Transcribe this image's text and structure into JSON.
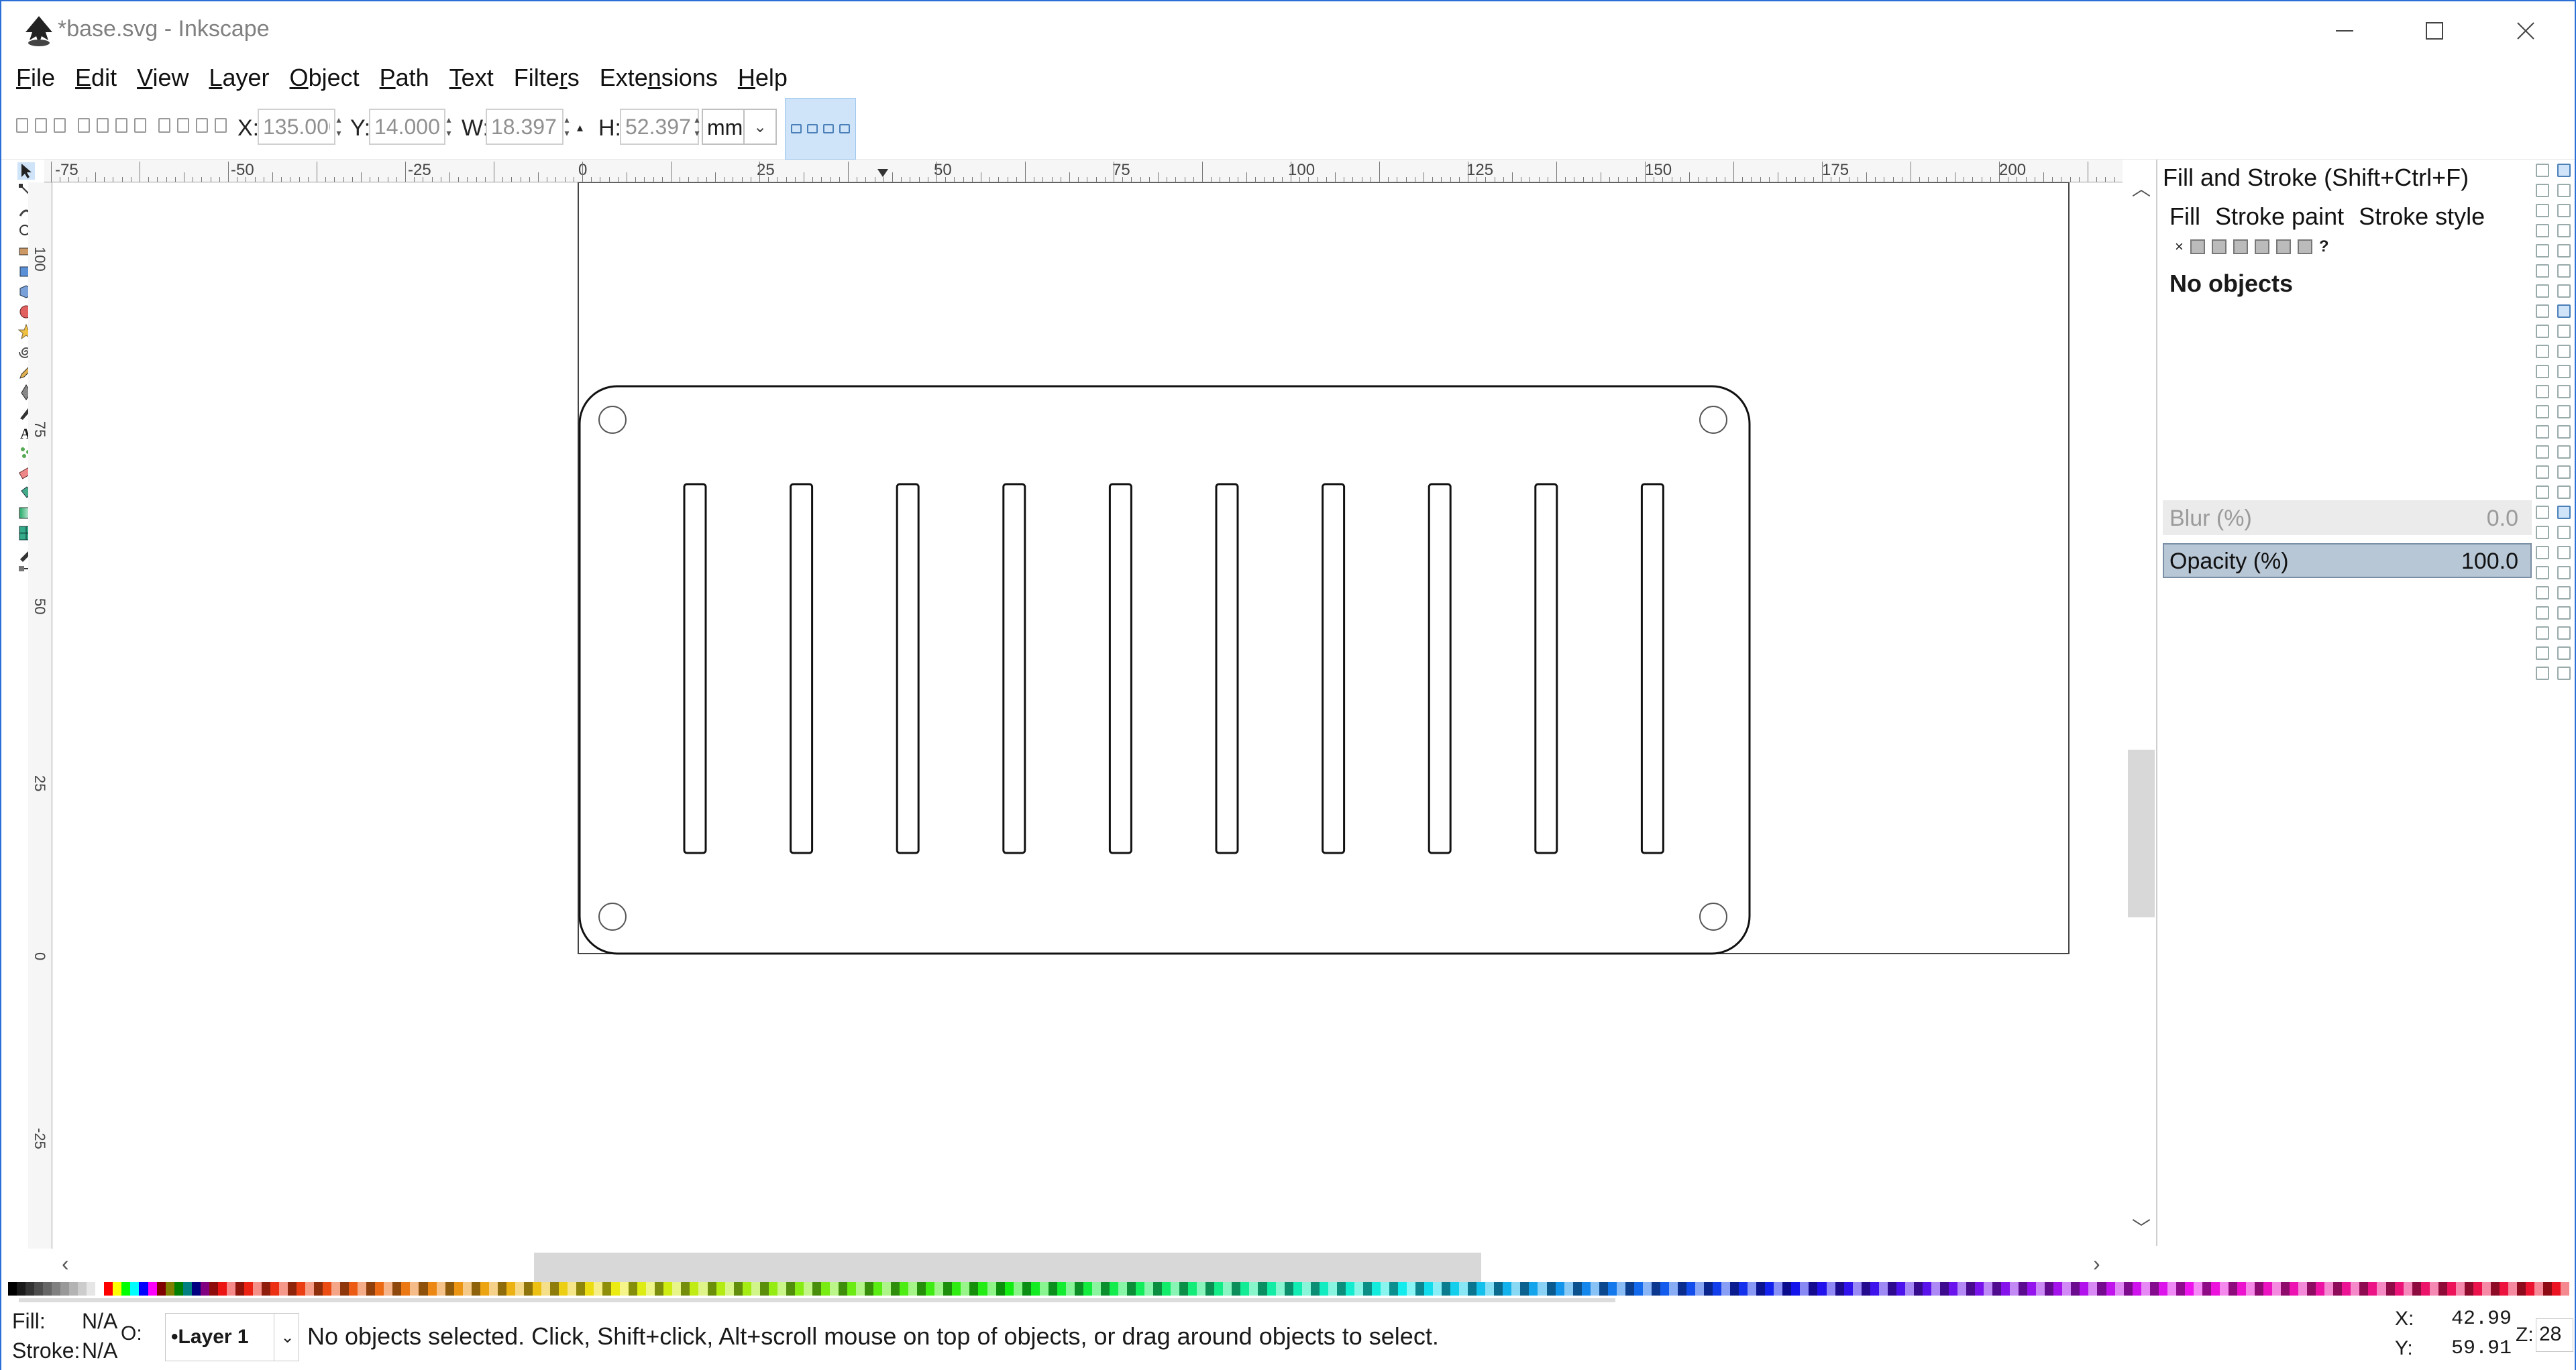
{
  "window": {
    "title": "*base.svg - Inkscape",
    "minimize_glyph": "—",
    "maximize_glyph": "☐",
    "close_glyph": "✕"
  },
  "menubar": {
    "items": [
      {
        "label": "File",
        "accel": "F"
      },
      {
        "label": "Edit",
        "accel": "E"
      },
      {
        "label": "View",
        "accel": "V"
      },
      {
        "label": "Layer",
        "accel": "L"
      },
      {
        "label": "Object",
        "accel": "O"
      },
      {
        "label": "Path",
        "accel": "P"
      },
      {
        "label": "Text",
        "accel": "T"
      },
      {
        "label": "Filters",
        "accel": "r"
      },
      {
        "label": "Extensions",
        "accel": "n"
      },
      {
        "label": "Help",
        "accel": "H"
      }
    ]
  },
  "tool_controls": {
    "x_label": "X:",
    "x_value": "135.000",
    "y_label": "Y:",
    "y_value": "14.000",
    "w_label": "W:",
    "w_value": "18.397",
    "h_label": "H:",
    "h_value": "52.397",
    "lock_glyph": "🔒",
    "unit": "mm"
  },
  "rulers": {
    "horizontal_labels": [
      "-75",
      "-50",
      "-25",
      "0",
      "25",
      "50",
      "75",
      "100",
      "125",
      "150",
      "175",
      "200"
    ],
    "vertical_labels": [
      "100",
      "75",
      "50",
      "25",
      "0",
      "-25"
    ]
  },
  "fill_stroke_dialog": {
    "title": "Fill and Stroke (Shift+Ctrl+F)",
    "tabs": [
      "Fill",
      "Stroke paint",
      "Stroke style"
    ],
    "no_paint_glyph": "×",
    "unknown_glyph": "?",
    "message": "No objects",
    "blur_label": "Blur (%)",
    "blur_value": "0.0",
    "opacity_label": "Opacity (%)",
    "opacity_value": "100.0"
  },
  "statusbar": {
    "fill_label": "Fill:",
    "fill_value": "N/A",
    "stroke_label": "Stroke:",
    "stroke_value": "N/A",
    "opacity_short": "O:",
    "layer": "•Layer 1",
    "message": "No objects selected. Click, Shift+click, Alt+scroll mouse on top of objects, or drag around objects to select.",
    "x_label": "X:",
    "x_value": "42.99",
    "y_label": "Y:",
    "y_value": "59.91",
    "zoom_label": "Z:",
    "zoom_value": "28"
  },
  "colors": {
    "accent": "#2b6fd6",
    "selection_highlight": "#cfe4f8",
    "opacity_row_bg": "#b8c7d6"
  },
  "drawing": {
    "slot_count": 10,
    "hole_count": 4
  }
}
